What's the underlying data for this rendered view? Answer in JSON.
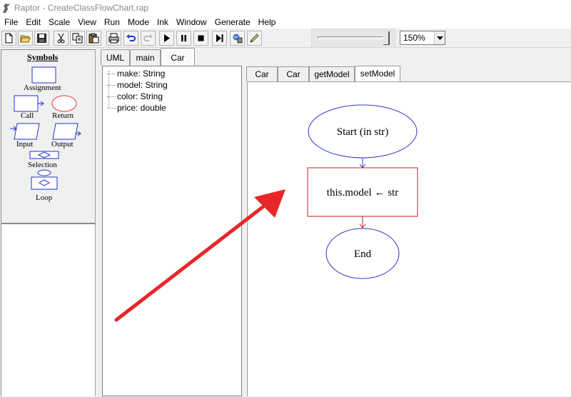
{
  "window": {
    "title": "Raptor - CreateClassFlowChart.rap",
    "app_icon": "raptor-dinosaur-icon"
  },
  "menu": [
    "File",
    "Edit",
    "Scale",
    "View",
    "Run",
    "Mode",
    "Ink",
    "Window",
    "Generate",
    "Help"
  ],
  "toolbar": {
    "buttons": [
      "new-file-icon",
      "open-folder-icon",
      "save-disk-icon",
      "cut-icon",
      "copy-icon",
      "paste-icon",
      "print-icon",
      "undo-icon",
      "redo-icon",
      "play-icon",
      "pause-icon",
      "stop-icon",
      "step-icon",
      "test-server-icon",
      "pencil-ink-icon"
    ],
    "zoom_value": "150%"
  },
  "symbols": {
    "title": "Symbols",
    "items": {
      "assignment": "Assignment",
      "call": "Call",
      "return": "Return",
      "input": "Input",
      "output": "Output",
      "selection": "Selection",
      "loop": "Loop"
    }
  },
  "class_tabs": {
    "uml": "UML",
    "main": "main",
    "car": "Car"
  },
  "uml_members": [
    "make: String",
    "model: String",
    "color: String",
    "price: double"
  ],
  "method_tabs": {
    "car1": "Car",
    "car2": "Car",
    "get_model": "getModel",
    "set_model": "setModel"
  },
  "flowchart": {
    "start": "Start (in str)",
    "assignment": "this.model ← str",
    "end": "End"
  },
  "colors": {
    "flow_shape_blue": "#3333cc",
    "assignment_red": "#cc2222",
    "annotation_arrow": "#e8262a",
    "return_symbol_red": "#ee3333"
  }
}
